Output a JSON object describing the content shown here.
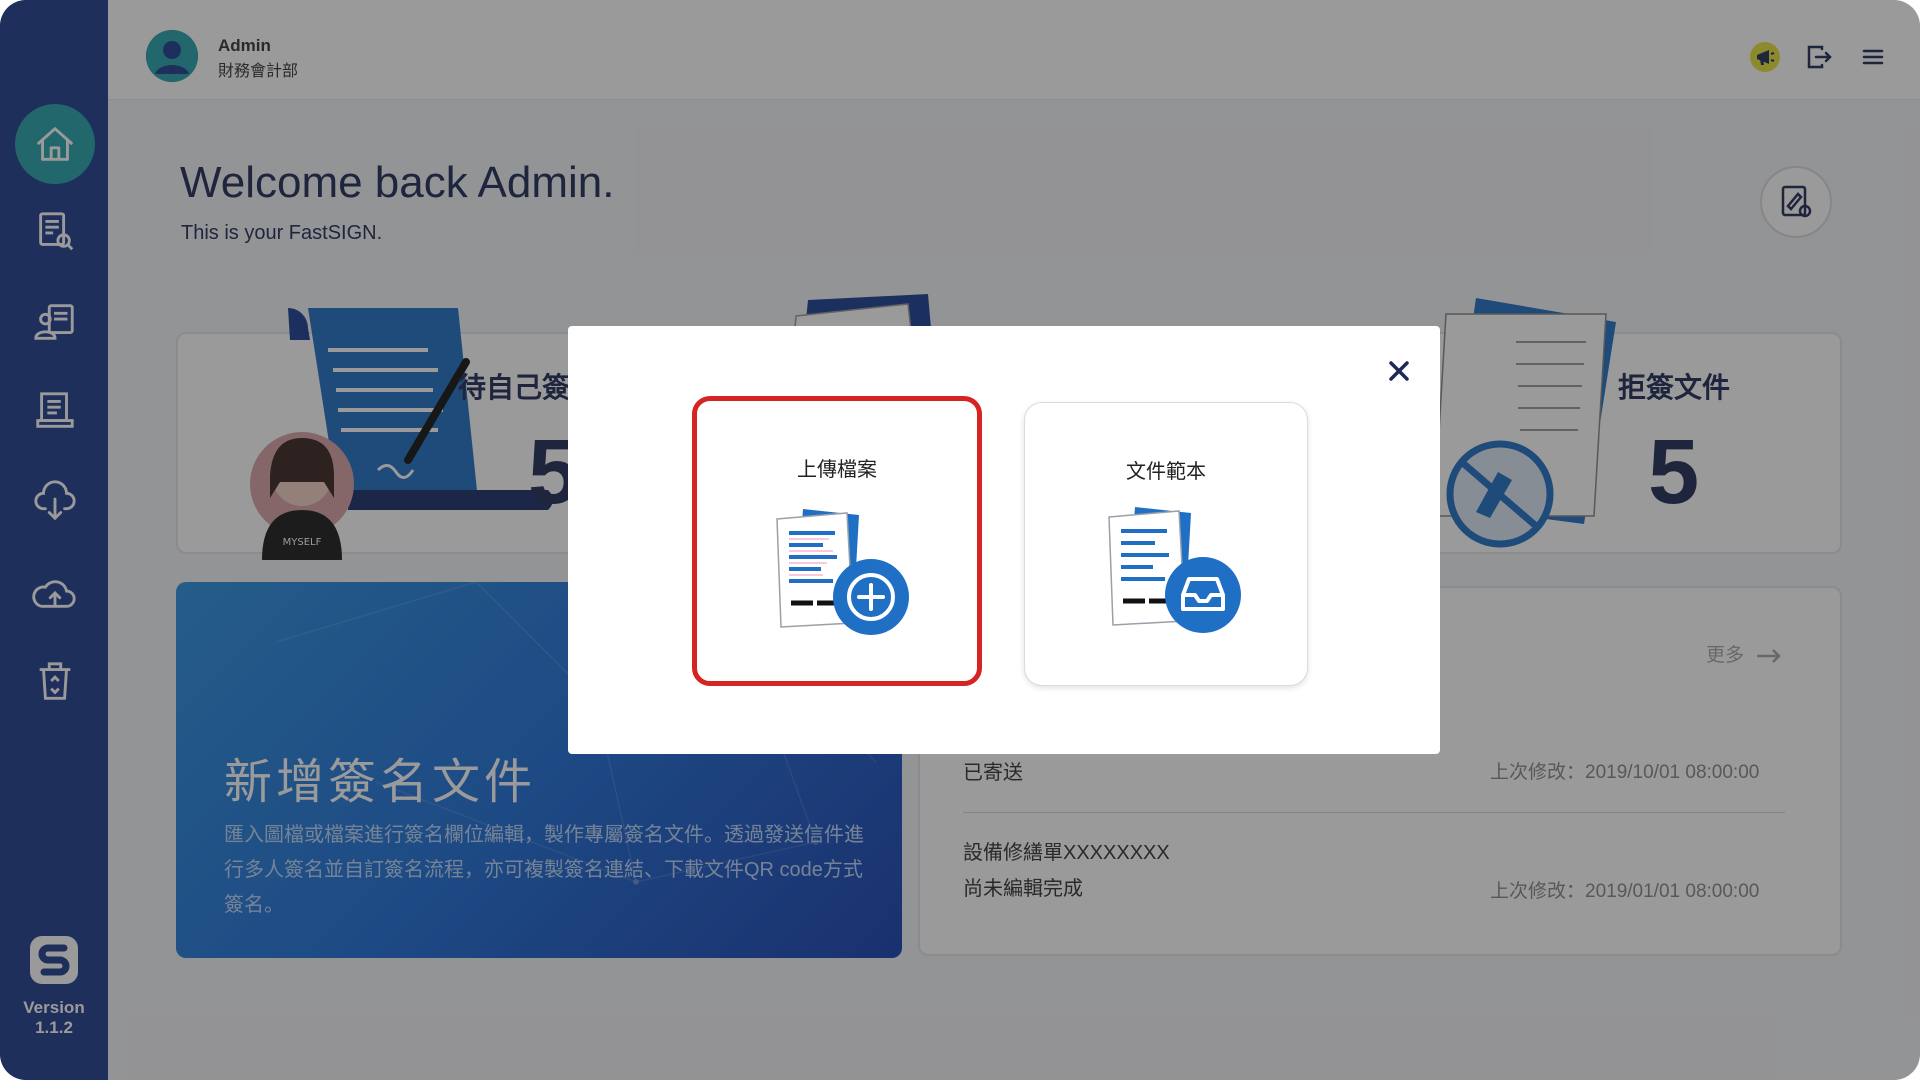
{
  "user": {
    "name": "Admin",
    "dept": "財務會計部"
  },
  "sidebar": {
    "items": [
      {
        "icon": "home-icon",
        "active": true
      },
      {
        "icon": "document-search-icon",
        "active": false
      },
      {
        "icon": "signer-icon",
        "active": false
      },
      {
        "icon": "document-list-icon",
        "active": false
      },
      {
        "icon": "cloud-download-icon",
        "active": false
      },
      {
        "icon": "cloud-upload-icon",
        "active": false
      },
      {
        "icon": "recycle-bin-icon",
        "active": false
      }
    ],
    "version_label": "Version",
    "version_number": "1.1.2"
  },
  "header": {
    "icons": [
      "megaphone-icon",
      "logout-icon",
      "menu-icon"
    ]
  },
  "welcome": {
    "title": "Welcome back Admin.",
    "subtitle": "This is your FastSIGN."
  },
  "stats": [
    {
      "label": "待自己簽",
      "value": "5"
    },
    {
      "label": "拒簽文件",
      "value": "5"
    }
  ],
  "promo": {
    "title": "新增簽名文件",
    "description": "匯入圖檔或檔案進行簽名欄位編輯，製作專屬簽名文件。透過發送信件進行多人簽名並自訂簽名流程，亦可複製簽名連結、下載文件QR code方式簽名。"
  },
  "recent": {
    "more_label": "更多",
    "items": [
      {
        "name": "",
        "status": "已寄送",
        "modified": "上次修改：2019/10/01 08:00:00"
      },
      {
        "name": "設備修繕單XXXXXXXX",
        "status": "尚未編輯完成",
        "modified": "上次修改：2019/01/01 08:00:00"
      }
    ]
  },
  "modal": {
    "options": [
      {
        "label": "上傳檔案",
        "icon": "upload-file-icon",
        "selected": true
      },
      {
        "label": "文件範本",
        "icon": "template-icon",
        "selected": false
      }
    ],
    "colors": {
      "selected_border": "#d62424",
      "accent": "#1f6fc5"
    }
  },
  "colors": {
    "sidebar": "#1f3d8f",
    "active": "#23a3ac",
    "text": "#1e2a55"
  }
}
